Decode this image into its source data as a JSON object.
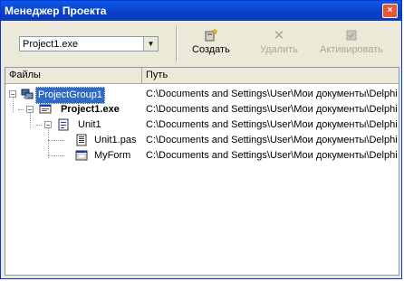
{
  "window": {
    "title": "Менеджер Проекта",
    "close_glyph": "×"
  },
  "toolbar": {
    "project_select": {
      "value": "Project1.exe"
    },
    "buttons": [
      {
        "label": "Создать",
        "icon": "new-item-icon",
        "enabled": true
      },
      {
        "label": "Удалить",
        "icon": "delete-icon",
        "enabled": false
      },
      {
        "label": "Активировать",
        "icon": "activate-icon",
        "enabled": false
      }
    ]
  },
  "columns": {
    "files": "Файлы",
    "path": "Путь"
  },
  "tree": [
    {
      "label": "ProjectGroup1",
      "path": "C:\\Documents and Settings\\User\\Мои документы\\Delphi",
      "icon": "project-group-icon",
      "selected": true,
      "bold": false
    },
    {
      "label": "Project1.exe",
      "path": "C:\\Documents and Settings\\User\\Мои документы\\Delphi",
      "icon": "project-exe-icon",
      "selected": false,
      "bold": true
    },
    {
      "label": "Unit1",
      "path": "C:\\Documents and Settings\\User\\Мои документы\\Delphi",
      "icon": "unit-icon",
      "selected": false,
      "bold": false
    },
    {
      "label": "Unit1.pas",
      "path": "C:\\Documents and Settings\\User\\Мои документы\\Delphi",
      "icon": "pas-file-icon",
      "selected": false,
      "bold": false
    },
    {
      "label": "MyForm",
      "path": "C:\\Documents and Settings\\User\\Мои документы\\Delphi",
      "icon": "form-icon",
      "selected": false,
      "bold": false
    }
  ]
}
